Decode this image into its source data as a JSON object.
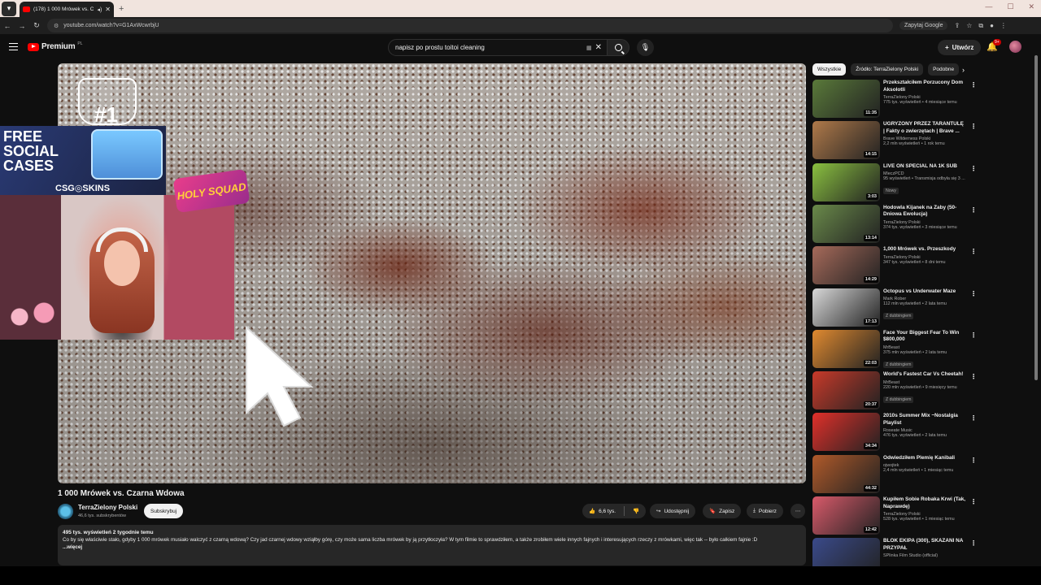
{
  "browser": {
    "tab_title": "(178) 1 000 Mrówek vs. Cz",
    "url": "youtube.com/watch?v=G1AxWcwrbjU",
    "ask_google": "Zapytaj Google"
  },
  "header": {
    "logo_text": "Premium",
    "logo_suffix": "PL",
    "search_value": "napisz po prostu toitoi cleaning",
    "create_label": "Utwórz",
    "notifications_badge": "9+"
  },
  "video": {
    "title": "1 000 Mrówek vs. Czarna Wdowa",
    "channel": "TerraZielony Polski",
    "subscribers": "46,6 tys. subskrybentów",
    "subscribe_label": "Subskrybuj",
    "likes": "6,6 tys.",
    "share_label": "Udostępnij",
    "save_label": "Zapisz",
    "download_label": "Pobierz",
    "meta": "495 tys. wyświetleń  2 tygodnie temu",
    "description": "Co by się właściwie stało, gdyby 1 000 mrówek musiało walczyć z czarną wdową? Czy jad czarnej wdowy wziąłby górę, czy może sama liczba mrówek by ją przytłoczyła? W tym filmie to sprawdziłem, a także zrobiłem wiele innych fajnych i interesujących rzeczy z mrówkami, więc tak -- było całkiem fajnie :D",
    "more_label": "...więcej"
  },
  "overlay": {
    "rank": "#1",
    "ad_text": "FREE SOCIAL CASES",
    "ad_brand": "CSG◎SKINS",
    "holy": "HOLY SQUAD"
  },
  "chips": [
    "Wszystkie",
    "Źródło: TerraZielony Polski",
    "Podobne"
  ],
  "recommendations": [
    {
      "title": "Przekształciłem Porzucony Dom Aksolotli",
      "channel": "TerraZielony Polski",
      "views": "775 tys. wyświetleń • 4 miesiące temu",
      "duration": "11:35",
      "tag": "",
      "color": "#5a7a3a"
    },
    {
      "title": "UGRYZONY PRZEZ TARANTULĘ | Fakty o zwierzętach | Brave ...",
      "channel": "Brave Wilderness Polski",
      "views": "2,2 mln wyświetleń • 1 rok temu",
      "duration": "14:15",
      "tag": "",
      "color": "#b07a4a"
    },
    {
      "title": "LIVE ON SPECIAL NA 1K SUB",
      "channel": "MleczPCD",
      "views": "95 wyświetleń • Transmisja odbyła się 3 ...",
      "duration": "3:03",
      "tag": "Nowy",
      "color": "#8ac040"
    },
    {
      "title": "Hodowla Kijanek na Żaby (50-Dniowa Ewolucja)",
      "channel": "TerraZielony Polski",
      "views": "374 tys. wyświetleń • 3 miesiące temu",
      "duration": "13:14",
      "tag": "",
      "color": "#6a8a4a"
    },
    {
      "title": "1,000 Mrówek vs. Przeszkody",
      "channel": "TerraZielony Polski",
      "views": "347 tys. wyświetleń • 8 dni temu",
      "duration": "14:29",
      "tag": "",
      "color": "#a66a5a"
    },
    {
      "title": "Octopus vs Underwater Maze",
      "channel": "Mark Rober",
      "views": "112 mln wyświetleń • 2 lata temu",
      "duration": "17:13",
      "tag": "Z dubbingiem",
      "color": "#d8d8d8"
    },
    {
      "title": "Face Your Biggest Fear To Win $800,000",
      "channel": "MrBeast",
      "views": "375 mln wyświetleń • 2 lata temu",
      "duration": "22:03",
      "tag": "Z dubbingiem",
      "color": "#e08a30"
    },
    {
      "title": "World's Fastest Car Vs Cheetah!",
      "channel": "MrBeast",
      "views": "220 mln wyświetleń • 9 miesięcy temu",
      "duration": "20:37",
      "tag": "Z dubbingiem",
      "color": "#c83a2a"
    },
    {
      "title": "2010s Summer Mix ~Nostalgia Playlist",
      "channel": "Roseate Music",
      "views": "476 tys. wyświetleń • 2 lata temu",
      "duration": "34:34",
      "tag": "",
      "color": "#e0302a"
    },
    {
      "title": "Odwiedziłem Plemię Kanibali",
      "channel": "ojwojtek",
      "views": "2,4 mln wyświetleń • 1 miesiąc temu",
      "duration": "44:32",
      "tag": "",
      "color": "#b05a2a"
    },
    {
      "title": "Kupiłem Sobie Robaka Krwi (Tak, Naprawdę)",
      "channel": "TerraZielony Polski",
      "views": "528 tys. wyświetleń • 1 miesiąc temu",
      "duration": "12:42",
      "tag": "",
      "color": "#d85a6a"
    },
    {
      "title": "BLOK EKIPA (300), SKAZANI NA PRZYPAŁ",
      "channel": "SPlinka Film Studio (official)",
      "views": "",
      "duration": "",
      "tag": "",
      "color": "#3a4a8a"
    }
  ]
}
